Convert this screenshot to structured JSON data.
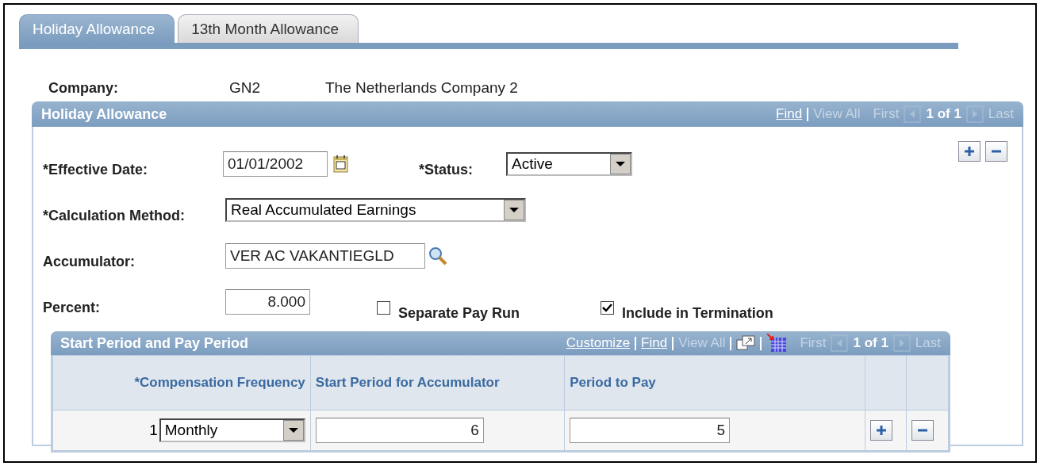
{
  "tabs": [
    {
      "label": "Holiday Allowance",
      "selected": true
    },
    {
      "label": "13th Month Allowance",
      "selected": false
    }
  ],
  "company": {
    "label": "Company:",
    "code": "GN2",
    "name": "The Netherlands Company 2"
  },
  "section": {
    "title": "Holiday Allowance",
    "nav": {
      "find": "Find",
      "view_all": "View All",
      "first": "First",
      "count": "1 of 1",
      "last": "Last"
    },
    "effective_date": {
      "label": "*Effective Date:",
      "value": "01/01/2002"
    },
    "status": {
      "label": "*Status:",
      "value": "Active"
    },
    "calculation_method": {
      "label": "*Calculation Method:",
      "value": "Real Accumulated Earnings"
    },
    "accumulator": {
      "label": "Accumulator:",
      "value": "VER AC VAKANTIEGLD"
    },
    "percent": {
      "label": "Percent:",
      "value": "8.000"
    },
    "checkboxes": [
      {
        "label": "Separate Pay Run",
        "checked": false
      },
      {
        "label": "Include in Termination",
        "checked": true
      }
    ],
    "grid": {
      "title": "Start Period and Pay Period",
      "nav": {
        "customize": "Customize",
        "find": "Find",
        "view_all": "View All",
        "first": "First",
        "count": "1 of 1",
        "last": "Last"
      },
      "columns": [
        "*Compensation Frequency",
        "Start Period for Accumulator",
        "Period to Pay"
      ],
      "rows": [
        {
          "number": "1",
          "frequency": "Monthly",
          "start_period": "6",
          "period_to_pay": "5"
        }
      ]
    }
  }
}
